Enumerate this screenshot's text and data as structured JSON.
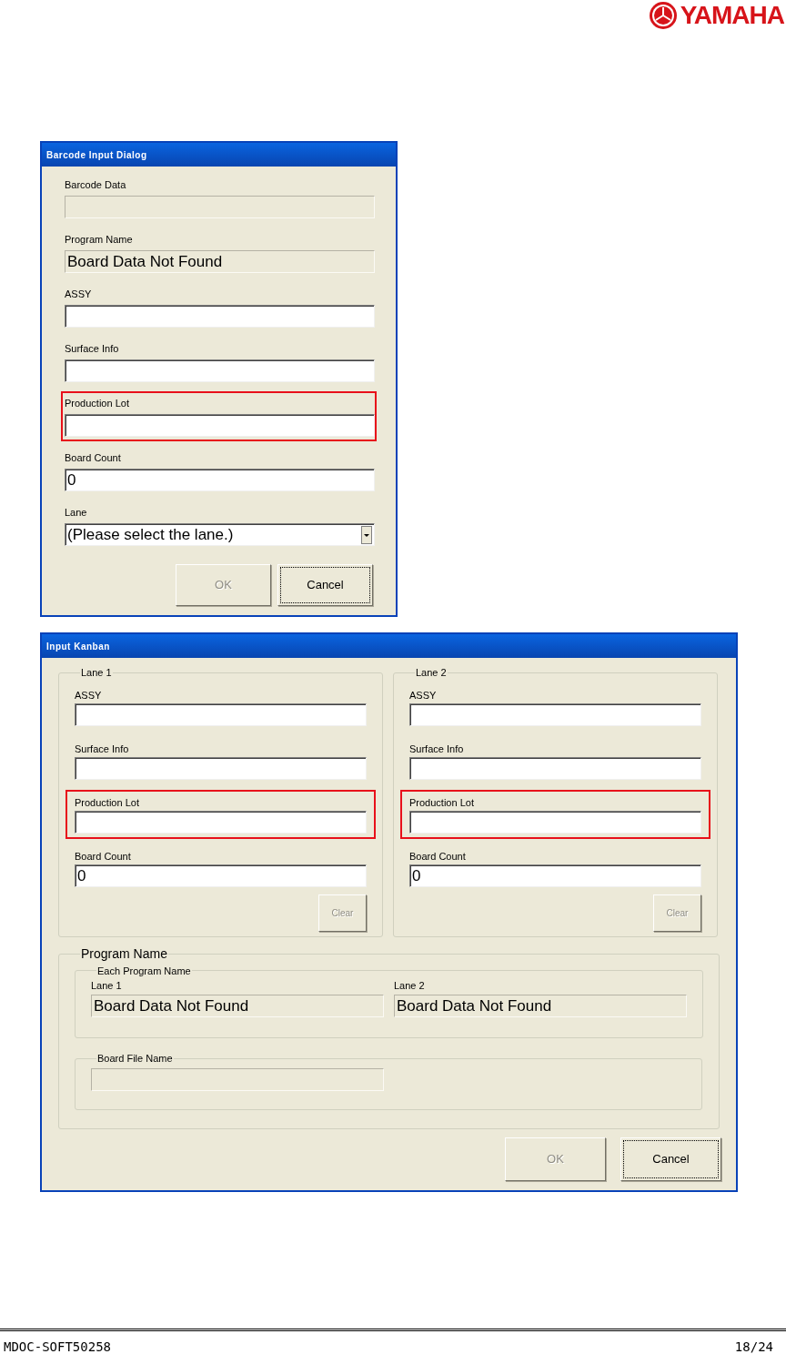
{
  "logo": {
    "text": "YAMAHA"
  },
  "barcode_dialog": {
    "title": "Barcode Input Dialog",
    "fields": [
      {
        "label": "Barcode Data",
        "kind": "readonly",
        "highlighted": false
      },
      {
        "label": "Program Name",
        "kind": "readonly",
        "value": "Board Data Not Found",
        "highlighted": false
      },
      {
        "label": "ASSY",
        "kind": "text",
        "highlighted": false
      },
      {
        "label": "Surface Info",
        "kind": "text",
        "highlighted": false
      },
      {
        "label": "Production Lot",
        "kind": "text",
        "highlighted": true
      },
      {
        "label": "Board Count",
        "kind": "text",
        "value": "0",
        "highlighted": false
      },
      {
        "label": "Lane",
        "kind": "dropdown",
        "value": "(Please select the lane.)",
        "highlighted": false
      }
    ],
    "buttons": [
      {
        "label": "OK",
        "disabled": true,
        "focused": false
      },
      {
        "label": "Cancel",
        "disabled": false,
        "focused": true
      }
    ]
  },
  "kanban_dialog": {
    "title": "Input Kanban",
    "lanes": [
      {
        "title": "Lane 1",
        "fields": [
          {
            "label": "ASSY",
            "highlighted": false
          },
          {
            "label": "Surface Info",
            "highlighted": false
          },
          {
            "label": "Production Lot",
            "highlighted": true
          },
          {
            "label": "Board Count",
            "value": "0",
            "highlighted": false
          }
        ],
        "clear_button": {
          "label": "Clear",
          "disabled": true
        }
      },
      {
        "title": "Lane 2",
        "fields": [
          {
            "label": "ASSY",
            "highlighted": false
          },
          {
            "label": "Surface Info",
            "highlighted": false
          },
          {
            "label": "Production Lot",
            "highlighted": true
          },
          {
            "label": "Board Count",
            "value": "0",
            "highlighted": false
          }
        ],
        "clear_button": {
          "label": "Clear",
          "disabled": true
        }
      }
    ],
    "program_name": {
      "title": "Program Name",
      "each": {
        "title": "Each Program Name",
        "lanes": [
          {
            "label": "Lane 1",
            "value": "Board Data Not Found"
          },
          {
            "label": "Lane 2",
            "value": "Board Data Not Found"
          }
        ]
      },
      "board_file": {
        "title": "Board File Name"
      }
    },
    "buttons": [
      {
        "label": "OK",
        "disabled": true,
        "focused": false
      },
      {
        "label": "Cancel",
        "disabled": false,
        "focused": true
      }
    ]
  },
  "footer": {
    "doc_id": "MDOC-SOFT50258",
    "page": "18/24"
  }
}
